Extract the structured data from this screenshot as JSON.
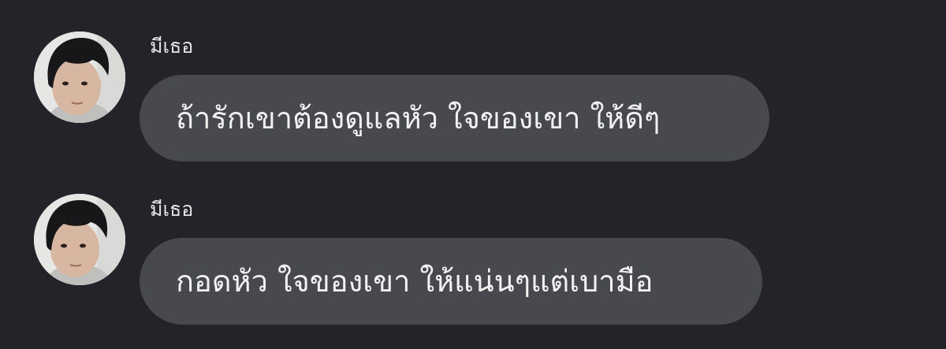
{
  "chat": {
    "messages": [
      {
        "sender": "มีเธอ",
        "text": "ถ้ารักเขาต้องดูแลหัว ใจของเขา ให้ดีๆ"
      },
      {
        "sender": "มีเธอ",
        "text": "กอดหัว ใจของเขา ให้แน่นๆแต่เบามือ"
      }
    ]
  },
  "colors": {
    "background": "#232329",
    "bubble": "#48484f",
    "text": "#f2f2f2",
    "sender_text": "#e6e6e6"
  },
  "icons": {
    "avatar": "user-avatar-photo"
  }
}
